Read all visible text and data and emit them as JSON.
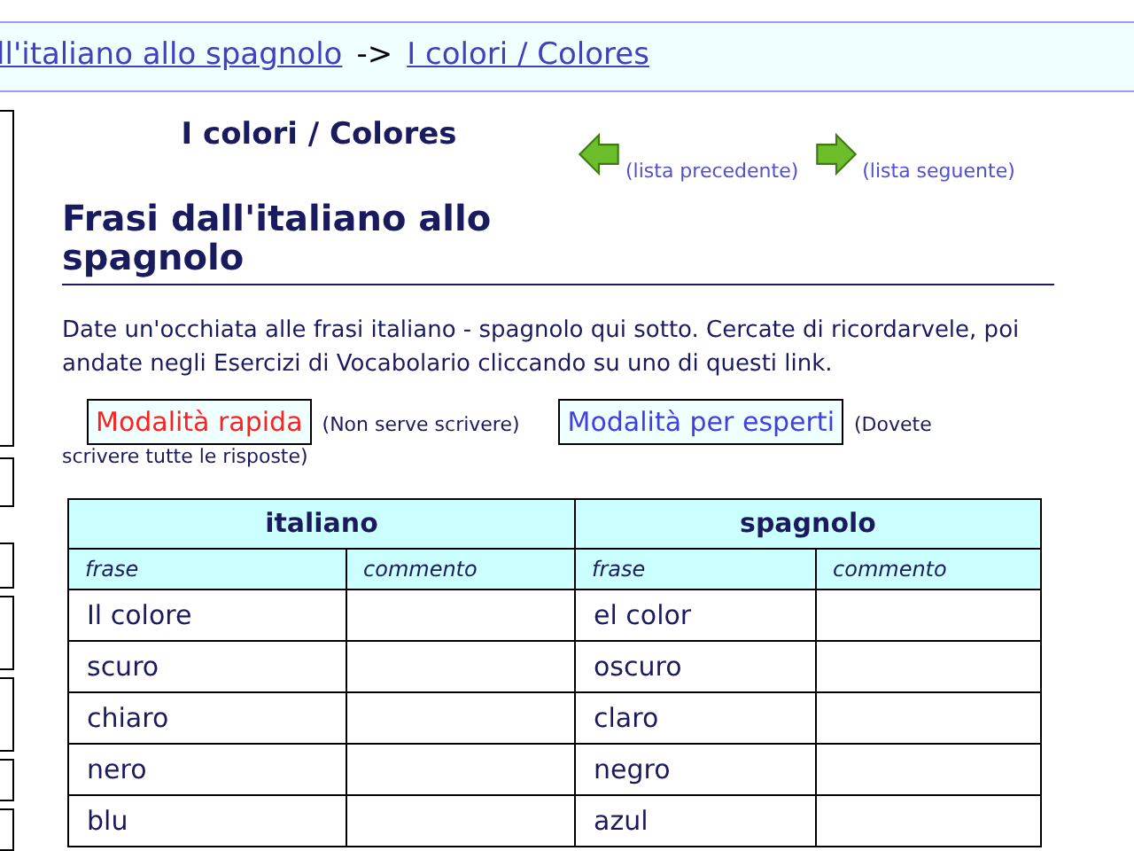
{
  "breadcrumb": {
    "parent_link": "ll'italiano allo spagnolo",
    "separator": "->",
    "current_link": "I colori / Colores"
  },
  "list_title": "I colori / Colores",
  "nav": [
    {
      "kind": "prev",
      "label": "(lista precedente)"
    },
    {
      "kind": "next",
      "label": "(lista seguente)"
    }
  ],
  "heading": "Frasi dall'italiano allo spagnolo",
  "intro": "Date un'occhiata alle frasi italiano - spagnolo qui sotto. Cercate di ricordarvele, poi andate negli Esercizi di Vocabolario cliccando su uno di questi link.",
  "modes": [
    {
      "label": "Modalità rapida",
      "note": "(Non serve scrivere)",
      "hovered": true
    },
    {
      "label": "Modalità per esperti",
      "note": "(Dovete",
      "note_continued": "scrivere tutte le risposte)",
      "hovered": false
    }
  ],
  "table": {
    "groups": [
      "italiano",
      "spagnolo"
    ],
    "columns": [
      "frase",
      "commento",
      "frase",
      "commento"
    ],
    "rows": [
      [
        "Il colore",
        "el color"
      ],
      [
        "scuro",
        "oscuro"
      ],
      [
        "chiaro",
        "claro"
      ],
      [
        "nero",
        "negro"
      ],
      [
        "blu",
        "azul"
      ]
    ]
  }
}
